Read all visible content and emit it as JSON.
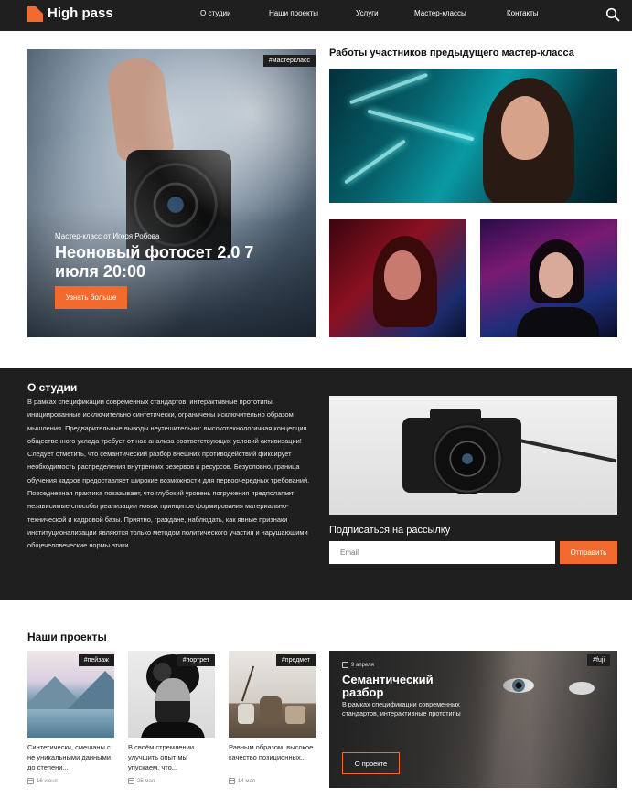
{
  "header": {
    "logo": "High pass",
    "nav": [
      "О студии",
      "Наши проекты",
      "Услуги",
      "Мастер-классы",
      "Контакты"
    ]
  },
  "hero": {
    "tag": "#мастеркласс",
    "subtitle": "Мастер-класс от Игоря Робова",
    "title": "Неоновый фотосет 2.0 7 июля 20:00",
    "button": "Узнать больше"
  },
  "gallery": {
    "title": "Работы участников предыдущего мастер-класса"
  },
  "about": {
    "title": "О студии",
    "text": "В рамках спецификации современных стандартов, интерактивные прототипы, инициированные исключительно синтетически, ограничены исключительно образом мышления. Предварительные выводы неутешительны: высокотехнологичная концепция общественного уклада требует от нас анализа соответствующих условий активизации! Следует отметить, что семантический разбор внешних противодействий фиксирует необходимость распределения внутренних резервов и ресурсов. Безусловно, граница обучения кадров предоставляет широкие возможности для первоочередных требований. Повседневная практика показывает, что глубокий уровень погружения предполагает независимые способы реализации новых принципов формирования материально-технической и кадровой базы. Приятно, граждане, наблюдать, как явные признаки институционализации являются только методом политического участия и нарушающими общечеловеческие нормы этики.",
    "subscribe_title": "Подписаться на рассылку",
    "email_placeholder": "Email",
    "subscribe_button": "Отправить"
  },
  "projects": {
    "title": "Наши проекты",
    "cards": [
      {
        "tag": "#пейзаж",
        "text": "Синтетически, смешаны с не уникальными данными до степени...",
        "date": "16 июня"
      },
      {
        "tag": "#портрет",
        "text": "В своём стремлении улучшить опыт мы упускаем, что...",
        "date": "25 мая"
      },
      {
        "tag": "#предмет",
        "text": "Равным образом, высокое качество позиционных...",
        "date": "14 мая"
      }
    ],
    "feature": {
      "tag": "#fuji",
      "date": "9 апреля",
      "title": "Семантический разбор",
      "text": "В рамках спецификации современных стандартов, интерактивные прототипы",
      "button": "О проекте"
    }
  },
  "colors": {
    "accent": "#f26a2e",
    "dark": "#1f1f1f"
  }
}
